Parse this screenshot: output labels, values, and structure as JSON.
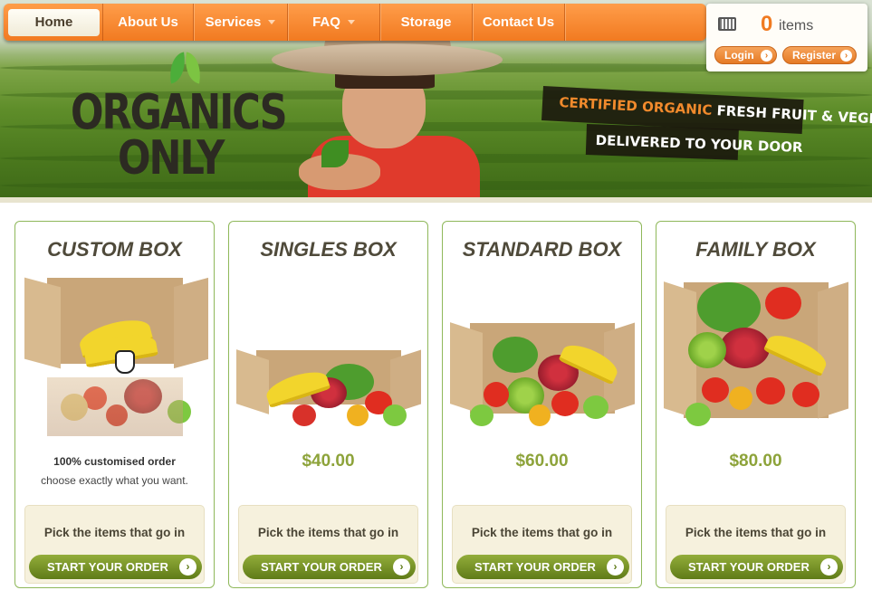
{
  "nav": {
    "items": [
      {
        "label": "Home",
        "dropdown": false
      },
      {
        "label": "About Us",
        "dropdown": false
      },
      {
        "label": "Services",
        "dropdown": true
      },
      {
        "label": "FAQ",
        "dropdown": true
      },
      {
        "label": "Storage",
        "dropdown": false
      },
      {
        "label": "Contact Us",
        "dropdown": false
      }
    ]
  },
  "cart": {
    "count": "0",
    "count_label": "items",
    "login_label": "Login",
    "register_label": "Register",
    "icon": "cart-icon"
  },
  "hero": {
    "logo_line1": "ORGANICS",
    "logo_line2": "ONLY",
    "tagline_accent": "CERTIFIED ORGANIC",
    "tagline_rest": " FRESH FRUIT & VEGIES",
    "tagline_line2": "DELIVERED TO YOUR DOOR"
  },
  "colors": {
    "accent": "#f17a21",
    "green_accent": "#8da33a",
    "card_border": "#8fb85a"
  },
  "products": [
    {
      "title": "CUSTOM BOX",
      "price": "",
      "desc_strong": "100% customised order",
      "desc": "choose exactly what you want.",
      "cta_text": "Pick the items that go in",
      "cta_button": "START YOUR ORDER"
    },
    {
      "title": "SINGLES BOX",
      "price": "$40.00",
      "desc_strong": "",
      "desc": "",
      "cta_text": "Pick the items that go in",
      "cta_button": "START YOUR ORDER"
    },
    {
      "title": "STANDARD BOX",
      "price": "$60.00",
      "desc_strong": "",
      "desc": "",
      "cta_text": "Pick the items that go in",
      "cta_button": "START YOUR ORDER"
    },
    {
      "title": "FAMILY BOX",
      "price": "$80.00",
      "desc_strong": "",
      "desc": "",
      "cta_text": "Pick the items that go in",
      "cta_button": "START YOUR ORDER"
    }
  ]
}
